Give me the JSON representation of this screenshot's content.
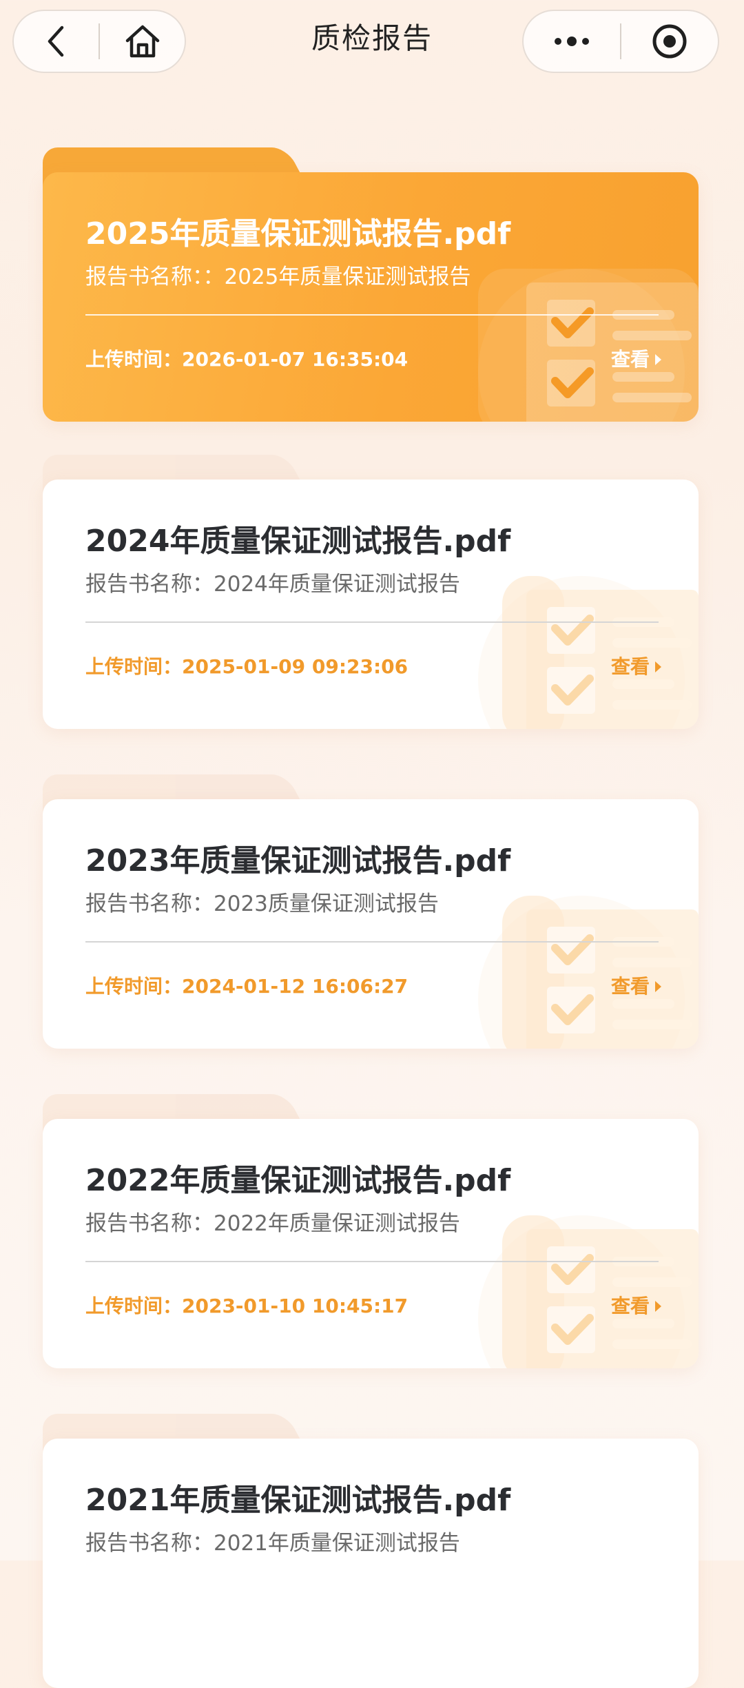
{
  "header": {
    "title": "质检报告",
    "back_icon": "chevron-left-icon",
    "home_icon": "home-icon",
    "more_icon": "more-dots-icon",
    "target_icon": "target-icon"
  },
  "colors": {
    "accent": "#f19a2b",
    "featured_card": "#fba736",
    "background": "#fdf0e6"
  },
  "reports": [
    {
      "title": "2025年质量保证测试报告.pdf",
      "name": "报告书名称：：2025年质量保证测试报告",
      "upload": "上传时间：2026-01-07 16:35:04",
      "view_label": "查看",
      "featured": true
    },
    {
      "title": "2024年质量保证测试报告.pdf",
      "name": "报告书名称：2024年质量保证测试报告",
      "upload": "上传时间：2025-01-09 09:23:06",
      "view_label": "查看",
      "featured": false
    },
    {
      "title": "2023年质量保证测试报告.pdf",
      "name": "报告书名称：2023质量保证测试报告",
      "upload": "上传时间：2024-01-12 16:06:27",
      "view_label": "查看",
      "featured": false
    },
    {
      "title": "2022年质量保证测试报告.pdf",
      "name": "报告书名称：2022年质量保证测试报告",
      "upload": "上传时间：2023-01-10 10:45:17",
      "view_label": "查看",
      "featured": false
    },
    {
      "title": "2021年质量保证测试报告.pdf",
      "name": "报告书名称：2021年质量保证测试报告",
      "upload": "",
      "view_label": "",
      "featured": false
    }
  ]
}
